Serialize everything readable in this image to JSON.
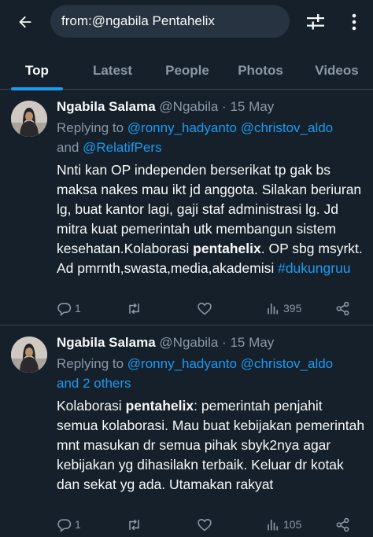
{
  "search": {
    "query": "from:@ngabila Pentahelix"
  },
  "tabs": [
    {
      "label": "Top"
    },
    {
      "label": "Latest"
    },
    {
      "label": "People"
    },
    {
      "label": "Photos"
    },
    {
      "label": "Videos"
    }
  ],
  "active_tab": "Top",
  "tweets": [
    {
      "name": "Ngabila Salama",
      "handle": "@Ngabila",
      "sep": "·",
      "date": "15 May",
      "replying_prefix": "Replying to ",
      "replying_mention1": "@ronny_hadyanto",
      "replying_mention2": "@christov_aldo",
      "replying_and": "and ",
      "replying_mention3": "@RelatifPers",
      "body_part1": "Nnti kan OP independen berserikat tp gak bs maksa nakes mau ikt jd anggota. Silakan beriuran lg, buat kantor lagi, gaji staf administrasi lg. Jd mitra kuat pemerintah utk membangun sistem kesehatan.Kolaborasi ",
      "body_highlight": "pentahelix",
      "body_part2": ". OP sbg msyrkt. Ad pmrnth,swasta,media,akademisi ",
      "body_hashtag": "#dukungruu",
      "replies": "1",
      "retweets": "",
      "likes": "",
      "views": "395"
    },
    {
      "name": "Ngabila Salama",
      "handle": "@Ngabila",
      "sep": "·",
      "date": "15 May",
      "replying_prefix": "Replying to ",
      "replying_mention1": "@ronny_hadyanto",
      "replying_mention2": "@christov_aldo",
      "replying_and": "and ",
      "replying_others": "2 others",
      "body_part1": "Kolaborasi ",
      "body_highlight": "pentahelix",
      "body_part2": ": pemerintah penjahit semua kolaborasi. Mau buat kebijakan pemerintah mnt masukan dr semua pihak sbyk2nya agar kebijakan yg dihasilakn terbaik. Keluar dr kotak dan sekat yg ada. Utamakan rakyat",
      "replies": "1",
      "retweets": "",
      "likes": "",
      "views": "105"
    }
  ],
  "colors": {
    "background": "#15202b",
    "accent": "#1d9bf0",
    "text_primary": "#f7f9f9",
    "text_secondary": "#8b98a5",
    "divider": "#38444d"
  },
  "icons": [
    "back-arrow-icon",
    "filter-sliders-icon",
    "more-vertical-icon",
    "reply-icon",
    "retweet-icon",
    "like-icon",
    "views-icon",
    "share-icon"
  ]
}
